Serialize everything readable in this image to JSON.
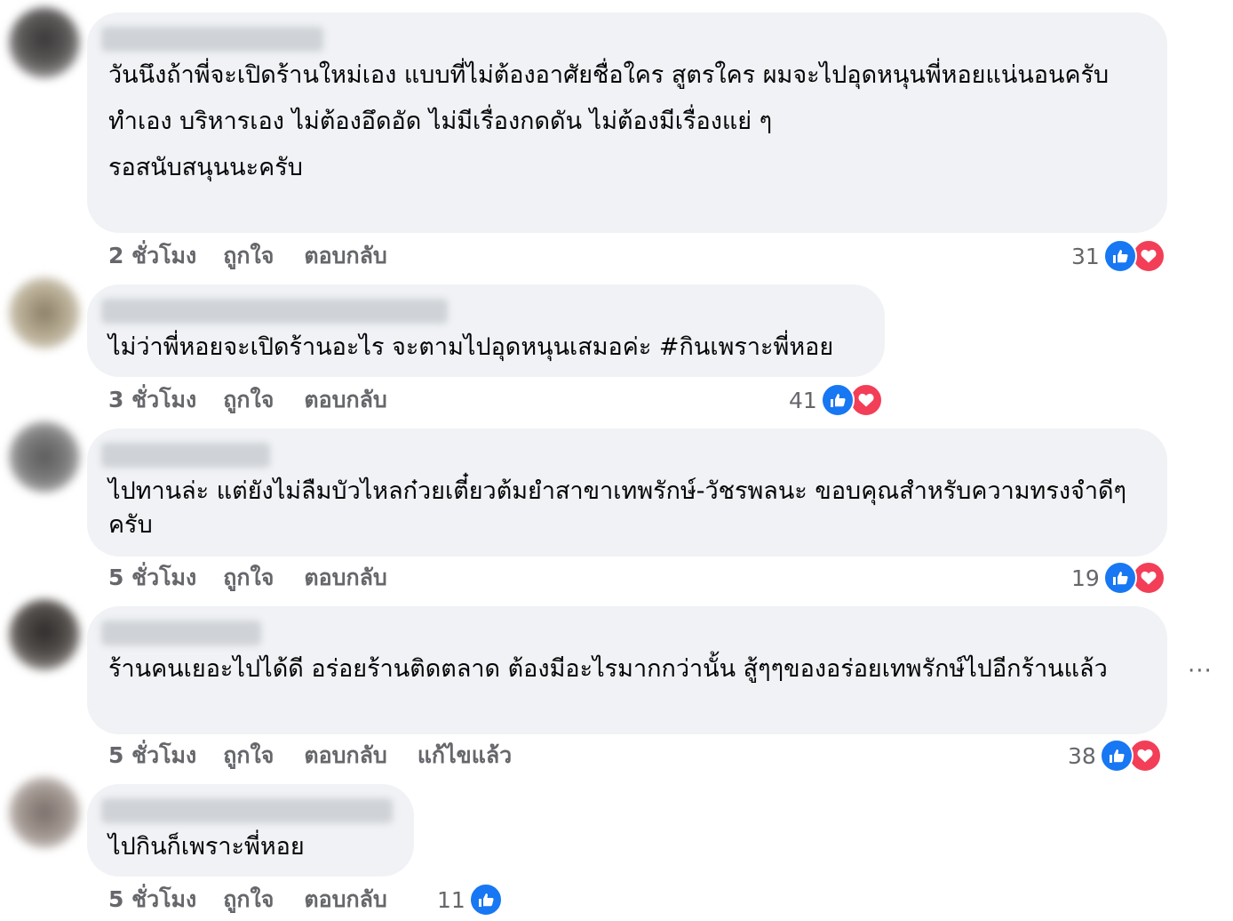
{
  "colors": {
    "bubble": "#f0f2f5",
    "meta_text": "#65676b",
    "like_blue": "#1877f2",
    "love_red": "#f33e58"
  },
  "comments": [
    {
      "paragraphs": [
        "วันนึงถ้าพี่จะเปิดร้านใหม่เอง แบบที่ไม่ต้องอาศัยชื่อใคร สูตรใคร ผมจะไปอุดหนุนพี่หอยแน่นอนครับ",
        "ทำเอง บริหารเอง ไม่ต้องอึดอัด ไม่มีเรื่องกดดัน ไม่ต้องมีเรื่องแย่ ๆ",
        "รอสนับสนุนนะครับ"
      ],
      "time": "2 ชั่วโมง",
      "like_label": "ถูกใจ",
      "reply_label": "ตอบกลับ",
      "reaction_count": "31",
      "reactions": [
        "like-icon",
        "love-icon"
      ]
    },
    {
      "paragraphs": [
        "ไม่ว่าพี่หอยจะเปิดร้านอะไร จะตามไปอุดหนุนเสมอค่ะ #กินเพราะพี่หอย"
      ],
      "time": "3 ชั่วโมง",
      "like_label": "ถูกใจ",
      "reply_label": "ตอบกลับ",
      "reaction_count": "41",
      "reactions": [
        "like-icon",
        "love-icon"
      ]
    },
    {
      "paragraphs": [
        "ไปทานล่ะ แต่ยังไม่ลืมบัวไหลก๋วยเตี๋ยวต้มยำสาขาเทพรักษ์-วัชรพลนะ ขอบคุณสำหรับความทรงจำดีๆครับ"
      ],
      "time": "5 ชั่วโมง",
      "like_label": "ถูกใจ",
      "reply_label": "ตอบกลับ",
      "reaction_count": "19",
      "reactions": [
        "like-icon",
        "love-icon"
      ]
    },
    {
      "paragraphs": [
        "ร้านคนเยอะไปได้ดี อร่อยร้านติดตลาด ต้องมีอะไรมากกว่านั้น สู้ๆๆของอร่อยเทพรักษ์ไปอีกร้านแล้ว"
      ],
      "time": "5 ชั่วโมง",
      "like_label": "ถูกใจ",
      "reply_label": "ตอบกลับ",
      "edited_label": "แก้ไขแล้ว",
      "reaction_count": "38",
      "reactions": [
        "like-icon",
        "love-icon"
      ]
    },
    {
      "paragraphs": [
        "ไปกินก็เพราะพี่หอย"
      ],
      "time": "5 ชั่วโมง",
      "like_label": "ถูกใจ",
      "reply_label": "ตอบกลับ",
      "reaction_count": "11",
      "reactions": [
        "like-icon"
      ]
    }
  ],
  "more_options": "···"
}
